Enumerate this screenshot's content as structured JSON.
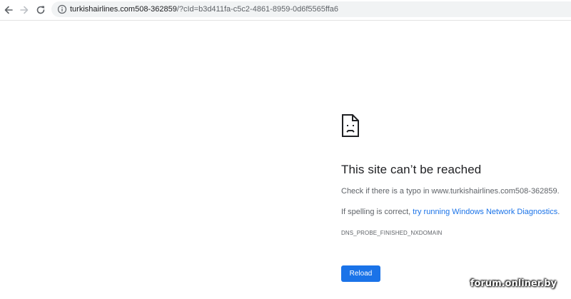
{
  "browser": {
    "url_host": "turkishairlines.com508-362859",
    "url_rest": "/?cId=b3d411fa-c5c2-4861-8959-0d6f5565ffa6",
    "icons": {
      "back": "back-arrow-icon",
      "forward": "forward-arrow-icon",
      "reload": "reload-icon",
      "info": "info-icon"
    }
  },
  "error": {
    "icon": "broken-document-icon",
    "title": "This site can’t be reached",
    "line1": "Check if there is a typo in www.turkishairlines.com508-362859.",
    "line2_prefix": "If spelling is correct, ",
    "line2_link": "try running Windows Network Diagnostics",
    "line2_suffix": ".",
    "code": "DNS_PROBE_FINISHED_NXDOMAIN",
    "reload_label": "Reload"
  },
  "watermark": "forum.onliner.by",
  "colors": {
    "accent": "#1a73e8",
    "text": "#202124",
    "muted": "#5f6368",
    "omnibox_bg": "#f1f3f4"
  }
}
